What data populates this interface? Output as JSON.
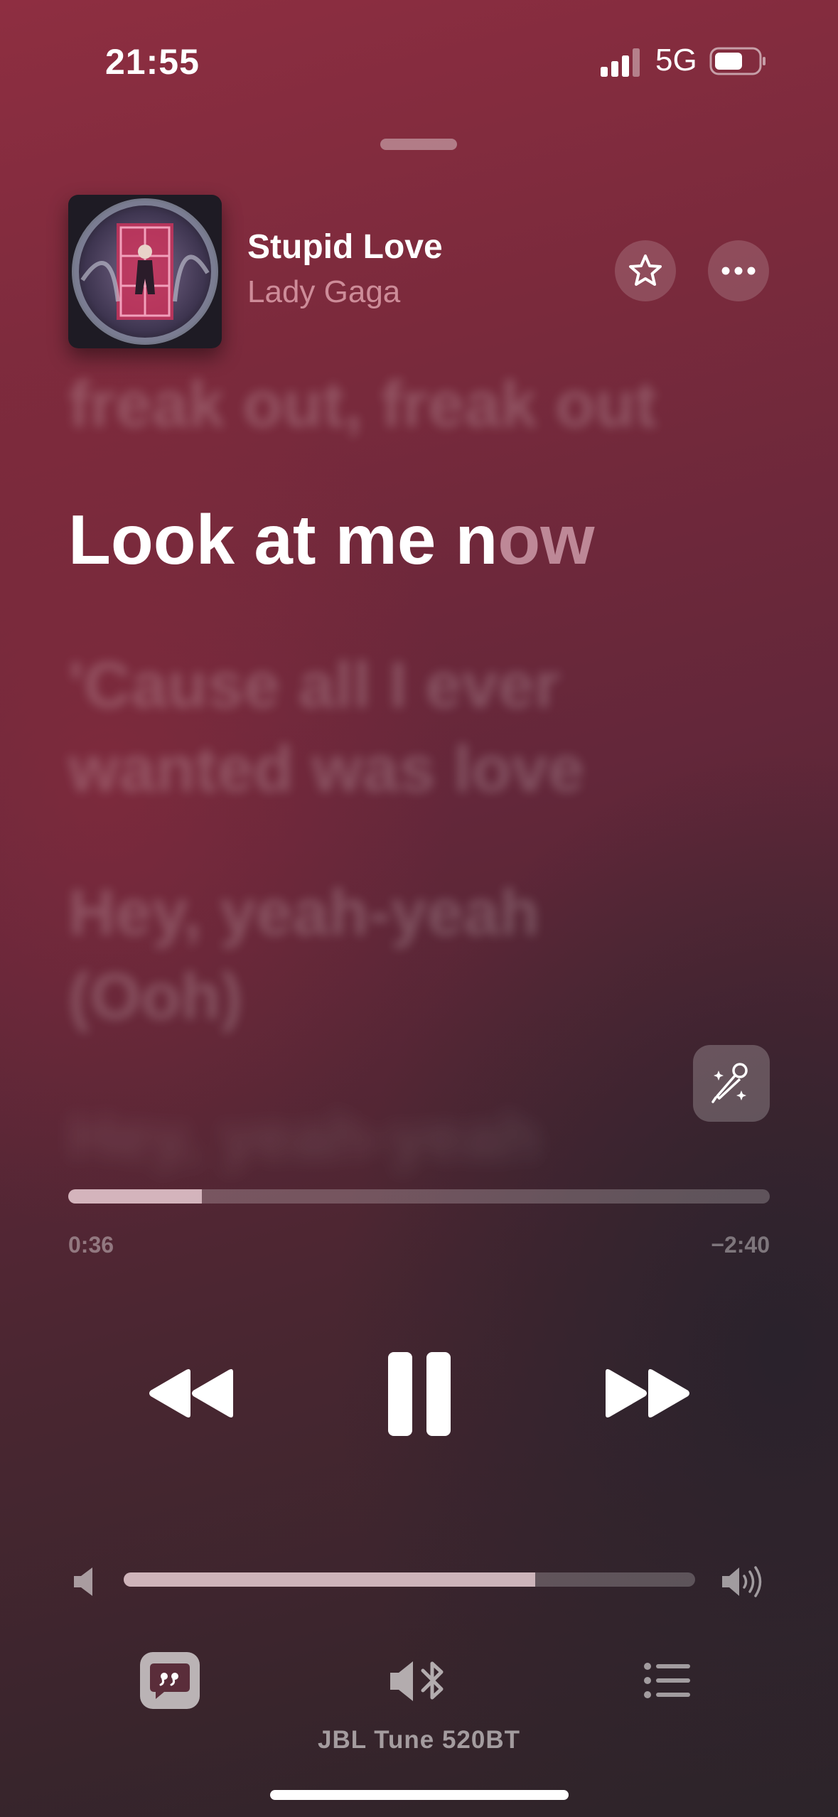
{
  "status_bar": {
    "time": "21:55",
    "network": "5G",
    "signal_icon": "signal-bars-icon",
    "battery_icon": "battery-icon"
  },
  "now_playing": {
    "title": "Stupid Love",
    "artist": "Lady Gaga",
    "artwork_icon": "album-artwork"
  },
  "actions": {
    "favorite_icon": "star-icon",
    "more_icon": "ellipsis-icon"
  },
  "lyrics": {
    "previous": "freak out, freak out",
    "current_sung": "Look at me n",
    "current_unsung": "ow",
    "next_1": "'Cause all I ever wanted was love",
    "next_2": "Hey, yeah-yeah (Ooh)",
    "next_3": "Hey, yeah-yeah"
  },
  "playback": {
    "elapsed": "0:36",
    "remaining": "−2:40",
    "progress_fraction": 0.19,
    "volume_fraction": 0.72
  },
  "controls": {
    "rewind_icon": "backward-icon",
    "pause_icon": "pause-icon",
    "forward_icon": "forward-icon",
    "sing_icon": "microphone-sparkle-icon",
    "volume_low_icon": "speaker-low-icon",
    "volume_high_icon": "speaker-high-icon"
  },
  "bottom_bar": {
    "lyrics_icon": "lyrics-quote-icon",
    "route_icon": "bluetooth-speaker-icon",
    "queue_icon": "list-icon",
    "device_name": "JBL Tune 520BT"
  },
  "colors": {
    "background_top": "#8e2e41",
    "background_bottom": "#2d2429",
    "accent_text": "#ffc8d2"
  }
}
